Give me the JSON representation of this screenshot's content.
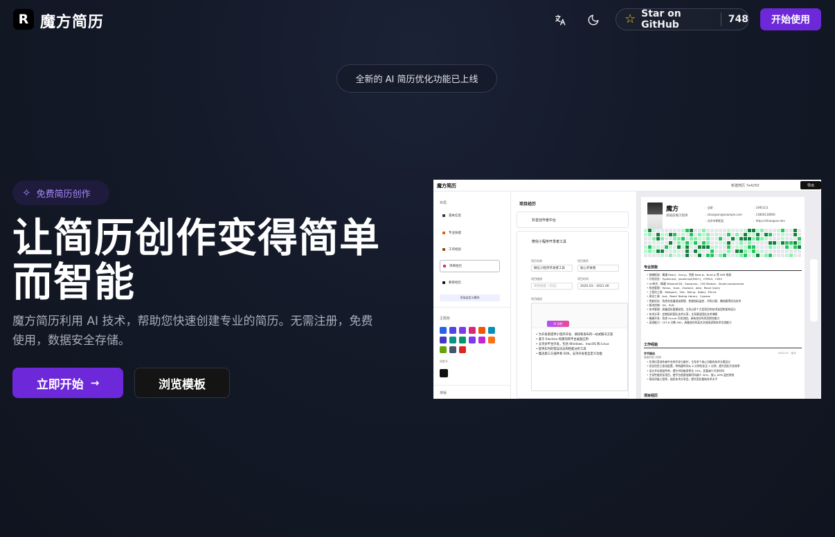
{
  "header": {
    "logo_letter": "R",
    "brand": "魔方简历",
    "translate_icon": "translate-icon",
    "theme_icon": "moon-icon",
    "github": {
      "label": "Star on GitHub",
      "count": "748",
      "icon": "star-icon"
    },
    "start_label": "开始使用"
  },
  "announcement": "全新的 AI 简历优化功能已上线",
  "hero": {
    "badge": "免费简历创作",
    "headline_line1": "让简历创作变得简单",
    "headline_line2": "而智能",
    "description_line1": "魔方简历利用 AI 技术，帮助您快速创建专业的简历。无需注册，免费",
    "description_line2": "使用，数据安全存储。",
    "cta_primary": "立即开始",
    "cta_primary_icon": "arrow-right-icon",
    "cta_secondary": "浏览模板"
  },
  "preview": {
    "app_title": "魔方简历",
    "resume_name": "新建简历 7e4250",
    "download": "导出",
    "left": {
      "layout_title": "布局",
      "items": [
        "基本信息",
        "专业技能",
        "工作经验",
        "项目经历",
        "教育经历"
      ],
      "add_button": "添加自定义模块",
      "theme_title": "主题色",
      "custom_label": "自定义",
      "typography_title": "排版",
      "swatches": [
        "#2563eb",
        "#4f46e5",
        "#7c3aed",
        "#db2777",
        "#ea580c",
        "#0891b2",
        "#4338ca",
        "#0d9488",
        "#059669",
        "#7c3aed",
        "#c026d3",
        "#f97316",
        "#65a30d",
        "#475569",
        "#dc2626"
      ]
    },
    "middle": {
      "section_title": "项目经历",
      "project1": "抖音创作者中台",
      "project2": "微信小程序开发者工具",
      "field_name_label": "项目名称",
      "field_name_value": "微信小程序开发者工具",
      "field_role_label": "项目角色",
      "field_role_value": "核心开发者",
      "field_link_label": "项目链接",
      "field_link_value": "项目链接（可选）",
      "field_time_label": "项目时间",
      "field_time_value": "2020.03 - 2021.06",
      "field_desc_label": "项目描述",
      "ai_label": "AI 润色",
      "bullets": [
        "为开发者提供小程序开发、调试和发布的一站式解决方案",
        "基于 Electron 构建的跨平台桌面应用",
        "支持多平台开发，包括 Windows、macOS 和 Linux",
        "提供实时的错误日志和性能分析工具",
        "集成第三方插件和 SDK，支持开发者自定义功能"
      ]
    },
    "resume": {
      "name": "魔方",
      "title": "高级前端工程师",
      "info": [
        "全职",
        "1995/1/1",
        "zhangsan@example.com",
        "13800138000",
        "北京市朝阳区",
        "https://zhangsan.dev"
      ],
      "skills_title": "专业技能",
      "skills": [
        "前端框架：精通 React、Vue.js，熟悉 Next.js、Nuxt.js 等 SSR 框架",
        "开发语言：TypeScript、JavaScript(ES6+)、HTML5、CSS3",
        "UI/样式：精通 TailwindCSS、Sass/Less、CSS Module、Styled-components",
        "状态管理：Redux、Vuex、Zustand、Jotai、React Query",
        "工程化工具：Webpack、Vite、Rollup、Babel、ESLint",
        "测试工具：Jest、React Testing Library、Cypress",
        "性能优化：熟悉浏览器渲染原理、性能指标监控、代码分割、懒加载等优化技术",
        "版本控制：Git、SVN",
        "技术管理：具备团队管理经验，主导过多个大型项目的技术选型和架构设计",
        "技术分享：定期组织团队技术分享，主导建设团队技术博客",
        "敏捷开发：熟悉 Scrum 开发流程，具有良好的项目把控能力",
        "英语能力：CET-6 分数 560，具备良好的英文文档阅读和技术交流能力"
      ],
      "work_title": "工作经验",
      "work_company": "字节跳动",
      "work_date": "2021.07 - 至今",
      "work_role": "高级前端工程师",
      "work_items": [
        "负责抖音创作者中台的开发与维护，主导多个核心功能的技术方案设计",
        "优化项目工程化配置，将构建时间从 8 分钟优化至 2 分钟，提升团队开发效率",
        "设计并实现组件库，提升代码复用率达 70%，显著减少开发时间",
        "主导性能优化项目，使平台首屏加载时间减少 50%，接入 APM 监控系统",
        "指导初级工程师，组织技术分享会，提升团队整体技术水平"
      ],
      "project_title": "项目经历"
    }
  }
}
